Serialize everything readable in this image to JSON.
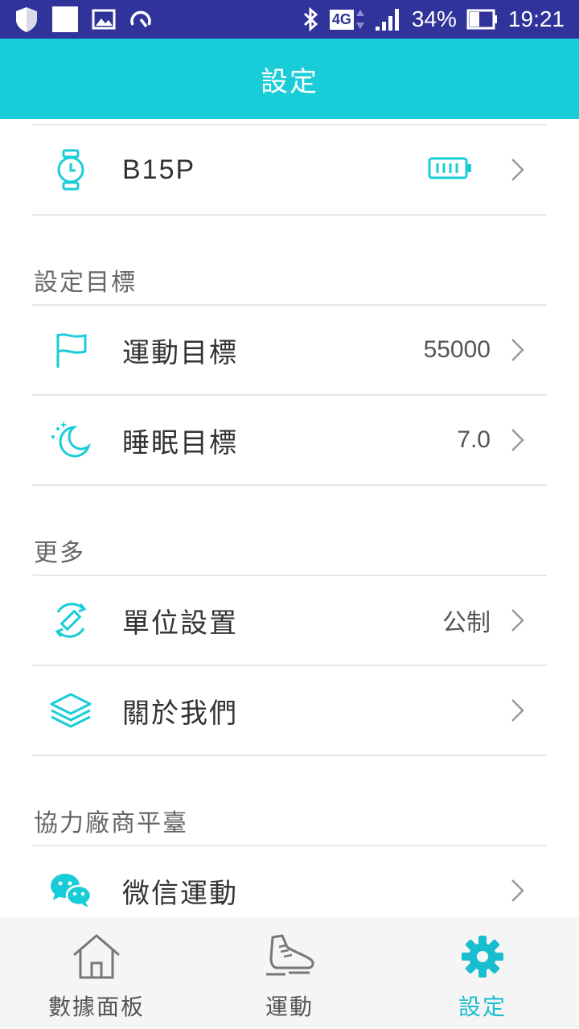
{
  "status_bar": {
    "network": "4G",
    "battery_percent": "34%",
    "time": "19:21"
  },
  "header": {
    "title": "設定"
  },
  "device": {
    "name": "B15P",
    "battery_icon": "battery-icon"
  },
  "sections": {
    "goals": {
      "title": "設定目標",
      "items": [
        {
          "label": "運動目標",
          "value": "55000",
          "icon": "flag-icon"
        },
        {
          "label": "睡眠目標",
          "value": "7.0",
          "icon": "moon-icon"
        }
      ]
    },
    "more": {
      "title": "更多",
      "items": [
        {
          "label": "單位設置",
          "value": "公制",
          "icon": "ruler-sync-icon"
        },
        {
          "label": "關於我們",
          "value": "",
          "icon": "layers-icon"
        }
      ]
    },
    "partners": {
      "title": "協力廠商平臺",
      "items": [
        {
          "label": "微信運動",
          "value": "",
          "icon": "wechat-icon"
        }
      ]
    }
  },
  "bottom_nav": {
    "items": [
      {
        "label": "數據面板",
        "icon": "home-icon",
        "active": false
      },
      {
        "label": "運動",
        "icon": "shoe-icon",
        "active": false
      },
      {
        "label": "設定",
        "icon": "gear-icon",
        "active": true
      }
    ]
  },
  "colors": {
    "status_bar": "#30339a",
    "accent": "#19cdd8",
    "nav_active": "#19bdd0"
  }
}
